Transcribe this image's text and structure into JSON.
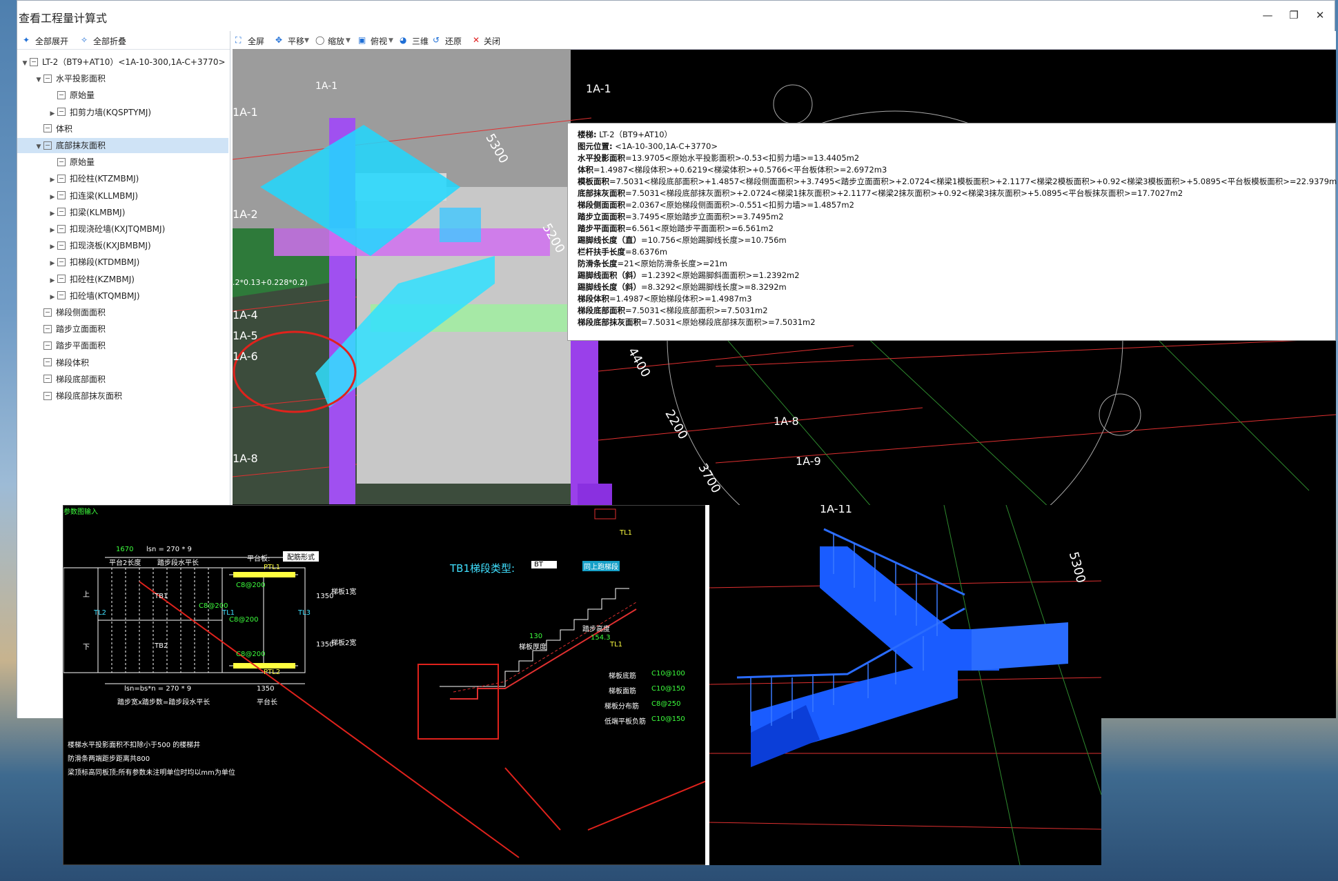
{
  "window": {
    "title": "查看工程量计算式"
  },
  "tree_toolbar": {
    "expand_all": "全部展开",
    "collapse_all": "全部折叠"
  },
  "tree": [
    {
      "label": "LT-2（BT9+AT10）<1A-10-300,1A-C+3770>",
      "level": 0,
      "expanded": true
    },
    {
      "label": "水平投影面积",
      "level": 1,
      "expanded": true
    },
    {
      "label": "原始量",
      "level": 2
    },
    {
      "label": "扣剪力墙(KQSPTYMJ)",
      "level": 2,
      "expandable": true
    },
    {
      "label": "体积",
      "level": 1
    },
    {
      "label": "底部抹灰面积",
      "level": 1,
      "expanded": true,
      "selected": true
    },
    {
      "label": "原始量",
      "level": 2
    },
    {
      "label": "扣砼柱(KTZMBMJ)",
      "level": 2,
      "expandable": true
    },
    {
      "label": "扣连梁(KLLMBMJ)",
      "level": 2,
      "expandable": true
    },
    {
      "label": "扣梁(KLMBMJ)",
      "level": 2,
      "expandable": true
    },
    {
      "label": "扣现浇砼墙(KXJTQMBMJ)",
      "level": 2,
      "expandable": true
    },
    {
      "label": "扣现浇板(KXJBMBMJ)",
      "level": 2,
      "expandable": true
    },
    {
      "label": "扣梯段(KTDMBMJ)",
      "level": 2,
      "expandable": true
    },
    {
      "label": "扣砼柱(KZMBMJ)",
      "level": 2,
      "expandable": true
    },
    {
      "label": "扣砼墙(KTQMBMJ)",
      "level": 2,
      "expandable": true
    },
    {
      "label": "梯段侧面面积",
      "level": 1
    },
    {
      "label": "踏步立面面积",
      "level": 1
    },
    {
      "label": "踏步平面面积",
      "level": 1
    },
    {
      "label": "梯段体积",
      "level": 1
    },
    {
      "label": "梯段底部面积",
      "level": 1
    },
    {
      "label": "梯段底部抹灰面积",
      "level": 1
    }
  ],
  "viewport_toolbar": {
    "fullscreen": "全屏",
    "pan": "平移",
    "zoom": "缩放",
    "top_view": "俯视",
    "view_3d": "三维",
    "restore": "还原",
    "close": "关闭"
  },
  "grid_labels": {
    "a1_top": "1A-1",
    "a1_right": "1A-1",
    "a1_left": "1A-1",
    "a2": "1A-2",
    "a4": "1A-4",
    "a5": "1A-5",
    "a6": "1A-6",
    "a8_left": "1A-8",
    "a8": "1A-8",
    "a9": "1A-9",
    "a11": "1A-11"
  },
  "dims": {
    "d5300": "5300",
    "d5200": "5200",
    "d4400": "4400",
    "d2200": "2200",
    "d3700": "3700",
    "formula_left": ".2*0.13+0.228*0.2)"
  },
  "info_lines": [
    {
      "k": "楼梯:",
      "v": " LT-2（BT9+AT10）"
    },
    {
      "k": "图元位置:",
      "v": "  <1A-10-300,1A-C+3770>"
    },
    {
      "k": "水平投影面积",
      "v": "=13.9705<原始水平投影面积>-0.53<扣剪力墙>=13.4405m2"
    },
    {
      "k": "体积",
      "v": "=1.4987<梯段体积>+0.6219<梯梁体积>+0.5766<平台板体积>=2.6972m3"
    },
    {
      "k": "模板面积",
      "v": "=7.5031<梯段底部面积>+1.4857<梯段侧面面积>+3.7495<踏步立面面积>+2.0724<梯梁1模板面积>+2.1177<梯梁2模板面积>+0.92<梯梁3模板面积>+5.0895<平台板模板面积>=22.9379m"
    },
    {
      "k": "底部抹灰面积",
      "v": "=7.5031<梯段底部抹灰面积>+2.0724<梯梁1抹灰面积>+2.1177<梯梁2抹灰面积>+0.92<梯梁3抹灰面积>+5.0895<平台板抹灰面积>=17.7027m2"
    },
    {
      "k": "梯段侧面面积",
      "v": "=2.0367<原始梯段侧面面积>-0.551<扣剪力墙>=1.4857m2"
    },
    {
      "k": "踏步立面面积",
      "v": "=3.7495<原始踏步立面面积>=3.7495m2"
    },
    {
      "k": "踏步平面面积",
      "v": "=6.561<原始踏步平面面积>=6.561m2"
    },
    {
      "k": "踢脚线长度（直）",
      "v": "=10.756<原始踢脚线长度>=10.756m"
    },
    {
      "k": "栏杆扶手长度",
      "v": "=8.6376m"
    },
    {
      "k": "防滑条长度",
      "v": "=21<原始防滑条长度>=21m"
    },
    {
      "k": "踢脚线面积（斜）",
      "v": "=1.2392<原始踢脚斜面面积>=1.2392m2"
    },
    {
      "k": "踢脚线长度（斜）",
      "v": "=8.3292<原始踢脚线长度>=8.3292m"
    },
    {
      "k": "梯段体积",
      "v": "=1.4987<原始梯段体积>=1.4987m3"
    },
    {
      "k": "梯段底部面积",
      "v": "=7.5031<梯段底部面积>=7.5031m2"
    },
    {
      "k": "梯段底部抹灰面积",
      "v": "=7.5031<原始梯段底部抹灰面积>=7.5031m2"
    }
  ],
  "cad": {
    "corner": "参数图输入",
    "dim_1670": "1670",
    "lsn_top": "lsn = 270 * 9",
    "platform_len": "平台2长度",
    "step_len": "踏步段水平长",
    "platform_board": "平台板:",
    "rebar_form": "配筋形式",
    "ptl1": "PTL1",
    "ptl2": "PTL2",
    "tl2": "TL2",
    "tl1_left": "TL1",
    "tl3": "TL3",
    "up": "上",
    "down": "下",
    "tb1": "TB1",
    "tb2": "TB2",
    "c8_1": "C8@200",
    "c8_2": "C8@200",
    "c8_3": "C8@200",
    "c8_4": "C8@200",
    "d1350a": "1350",
    "d1350b": "1350",
    "width1": "梯板1宽",
    "width2": "梯板2宽",
    "lsn_bottom": "lsn=bs*n = 270 * 9",
    "d1350": "1350",
    "step_formula": "踏步宽x踏步数=踏步段水平长",
    "platform_long": "平台长",
    "note1": "楼梯水平投影面积不扣除小于500 的楼梯井",
    "note2": "防滑条两端距步距离共800",
    "note3": "梁顶标高同板顶;所有参数未注明单位时均以mm为单位",
    "tb1_type_label": "TB1梯段类型:",
    "tb1_type_value": "BT",
    "same_as": "同上跑梯段",
    "tl1_top": "TL1",
    "tl1_mid": "TL1",
    "step_height": "踏步高度",
    "board_thick": "梯板厚度",
    "d130": "130",
    "d154": "154.3",
    "bottom_rebar": "梯板底筋",
    "bottom_rebar_v": "C10@100",
    "top_rebar": "梯板面筋",
    "top_rebar_v": "C10@150",
    "dist_rebar": "梯板分布筋",
    "dist_rebar_v": "C8@250",
    "low_end": "低端平板负筋",
    "low_end_v": "C10@150"
  },
  "stair3d": {
    "grid": "1A-11",
    "dim": "5300"
  },
  "colors": {
    "accent": "#1f6fd6",
    "stair_blue": "#1a5cff",
    "annot_red": "#e0221c",
    "cad_green": "#3dff3d",
    "cad_cyan": "#40e0ff"
  }
}
